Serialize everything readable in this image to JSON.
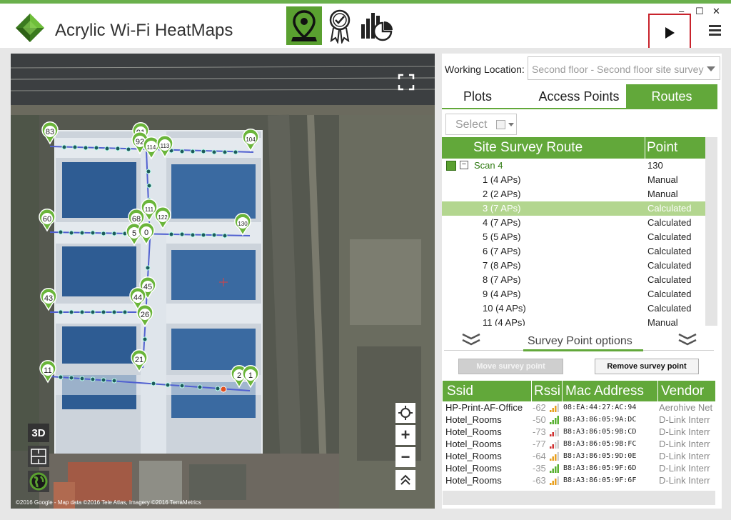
{
  "app": {
    "title": "Acrylic Wi-Fi HeatMaps"
  },
  "nav": [
    {
      "name": "map-pin-icon",
      "active": true
    },
    {
      "name": "certificate-icon",
      "active": false
    },
    {
      "name": "reports-chart-icon",
      "active": false
    }
  ],
  "window_controls": {
    "minimize": "–",
    "maximize": "☐",
    "close": "✕"
  },
  "map": {
    "attribution": "©2016 Google - Map data ©2016 Tele Atlas, Imagery ©2016 TerraMetrics",
    "controls": {
      "view_3d": "3D",
      "zoom_in": "+",
      "zoom_out": "−"
    },
    "markers": [
      {
        "label": "83"
      },
      {
        "label": "91"
      },
      {
        "label": "92"
      },
      {
        "label": "114"
      },
      {
        "label": "113"
      },
      {
        "label": "104"
      },
      {
        "label": "60"
      },
      {
        "label": "68"
      },
      {
        "label": "5"
      },
      {
        "label": "0"
      },
      {
        "label": "111"
      },
      {
        "label": "122"
      },
      {
        "label": "130"
      },
      {
        "label": "45"
      },
      {
        "label": "44"
      },
      {
        "label": "43"
      },
      {
        "label": "26"
      },
      {
        "label": "21"
      },
      {
        "label": "11"
      },
      {
        "label": "2"
      },
      {
        "label": "1"
      }
    ]
  },
  "working_location": {
    "label": "Working Location:",
    "value": "Second floor - Second floor site survey"
  },
  "tabs": [
    "Plots",
    "Access Points",
    "Routes"
  ],
  "active_tab": "Routes",
  "select": {
    "label": "Select"
  },
  "route_table": {
    "headers": {
      "route": "Site Survey Route",
      "point": "Point"
    },
    "scan": {
      "name": "Scan 4",
      "point": "130"
    },
    "rows": [
      {
        "route": "1 (4 APs)",
        "point": "Manual"
      },
      {
        "route": "2 (2 APs)",
        "point": "Manual"
      },
      {
        "route": "3 (7 APs)",
        "point": "Calculated"
      },
      {
        "route": "4 (7 APs)",
        "point": "Calculated"
      },
      {
        "route": "5 (5 APs)",
        "point": "Calculated"
      },
      {
        "route": "6 (7 APs)",
        "point": "Calculated"
      },
      {
        "route": "7 (8 APs)",
        "point": "Calculated"
      },
      {
        "route": "8 (7 APs)",
        "point": "Calculated"
      },
      {
        "route": "9 (4 APs)",
        "point": "Calculated"
      },
      {
        "route": "10 (4 APs)",
        "point": "Calculated"
      },
      {
        "route": "11 (4 APs)",
        "point": "Manual"
      }
    ],
    "selected_index": 2
  },
  "survey_options": {
    "title": "Survey Point options",
    "move_button": "Move survey point",
    "remove_button": "Remove survey point"
  },
  "ap_table": {
    "headers": {
      "ssid": "Ssid",
      "rssi": "Rssi",
      "mac": "Mac Address",
      "vendor": "Vendor"
    },
    "rows": [
      {
        "ssid": "HP-Print-AF-Office",
        "rssi": "-62",
        "mac": "08:EA:44:27:AC:94",
        "vendor": "Aerohive Net",
        "bars": 3,
        "color": "#e8a020"
      },
      {
        "ssid": "Hotel_Rooms",
        "rssi": "-50",
        "mac": "B8:A3:86:05:9A:DC",
        "vendor": "D-Link Interr",
        "bars": 4,
        "color": "#58b030"
      },
      {
        "ssid": "Hotel_Rooms",
        "rssi": "-73",
        "mac": "B8:A3:86:05:9B:CD",
        "vendor": "D-Link Interr",
        "bars": 2,
        "color": "#d03030"
      },
      {
        "ssid": "Hotel_Rooms",
        "rssi": "-77",
        "mac": "B8:A3:86:05:9B:FC",
        "vendor": "D-Link Interr",
        "bars": 2,
        "color": "#d03030"
      },
      {
        "ssid": "Hotel_Rooms",
        "rssi": "-64",
        "mac": "B8:A3:86:05:9D:0E",
        "vendor": "D-Link Interr",
        "bars": 3,
        "color": "#e8a020"
      },
      {
        "ssid": "Hotel_Rooms",
        "rssi": "-35",
        "mac": "B8:A3:86:05:9F:6D",
        "vendor": "D-Link Interr",
        "bars": 4,
        "color": "#58b030"
      },
      {
        "ssid": "Hotel_Rooms",
        "rssi": "-63",
        "mac": "B8:A3:86:05:9F:6F",
        "vendor": "D-Link Interr",
        "bars": 3,
        "color": "#e8a020"
      }
    ]
  },
  "colors": {
    "accent": "#62a83a",
    "selected_row": "#b3d68f",
    "highlight": "#c8232c"
  }
}
